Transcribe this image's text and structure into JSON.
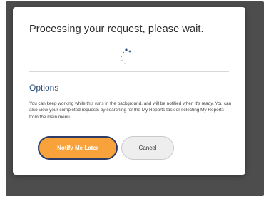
{
  "dialog": {
    "title": "Processing your request, please wait.",
    "options_heading": "Options",
    "options_text": "You can keep working while this runs in the background, and will be notified when it's ready. You can also view your completed requests by searching for the My Reports task or selecting My Reports from the main menu.",
    "spinner_icon": "loading-spinner-icon"
  },
  "buttons": {
    "notify_label": "Notify Me Later",
    "cancel_label": "Cancel"
  },
  "colors": {
    "primary_button": "#f7a23a",
    "primary_button_border": "#2c3c66",
    "heading_accent": "#2b4a7a",
    "overlay": "#4d4d4d"
  }
}
